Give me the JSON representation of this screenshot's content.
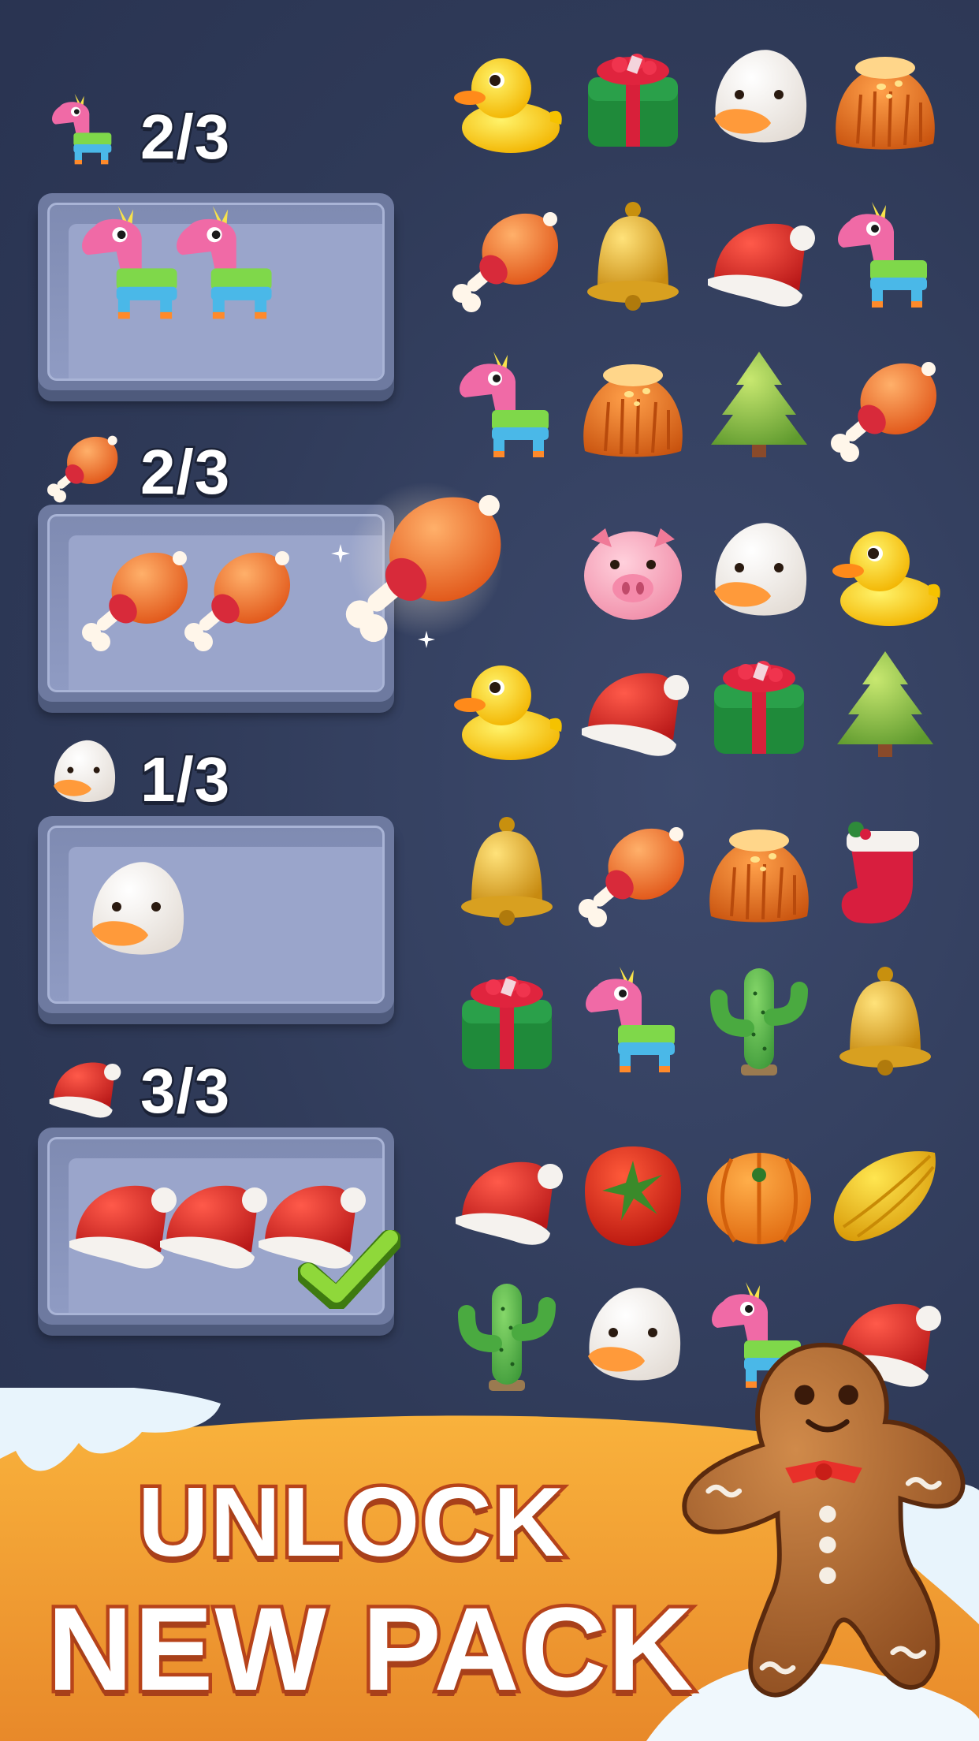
{
  "goals": [
    {
      "item": "pinata",
      "count": "2/3",
      "collected": 2,
      "target": 3,
      "complete": false
    },
    {
      "item": "drumstick",
      "count": "2/3",
      "collected": 2,
      "target": 3,
      "complete": false
    },
    {
      "item": "duck-head",
      "count": "1/3",
      "collected": 1,
      "target": 3,
      "complete": false
    },
    {
      "item": "santa-hat",
      "count": "3/3",
      "collected": 3,
      "target": 3,
      "complete": true
    }
  ],
  "board": [
    [
      "duck",
      "gift",
      "duck-head",
      "haystack"
    ],
    [
      "drumstick",
      "bell",
      "santa-hat",
      "pinata"
    ],
    [
      "pinata",
      "haystack",
      "tree",
      "drumstick"
    ],
    [
      "",
      "pig",
      "duck-head",
      "duck"
    ],
    [
      "duck",
      "santa-hat",
      "gift",
      "tree"
    ],
    [
      "bell",
      "drumstick",
      "haystack",
      "stocking"
    ],
    [
      "gift",
      "pinata",
      "cactus",
      "bell"
    ],
    [
      "santa-hat",
      "tomato",
      "pumpkin",
      "carambola"
    ],
    [
      "cactus",
      "duck-head",
      "pinata",
      "santa-hat"
    ]
  ],
  "flying_item": "drumstick",
  "banner": {
    "line1": "UNLOCK",
    "line2": "NEW PACK"
  },
  "mascot": "gingerbread-man",
  "colors": {
    "background": "#2f3a58",
    "tray": "#8f9bc3",
    "ground": "#f0a030",
    "snow": "#e8f4fc",
    "check": "#7cc62a"
  }
}
